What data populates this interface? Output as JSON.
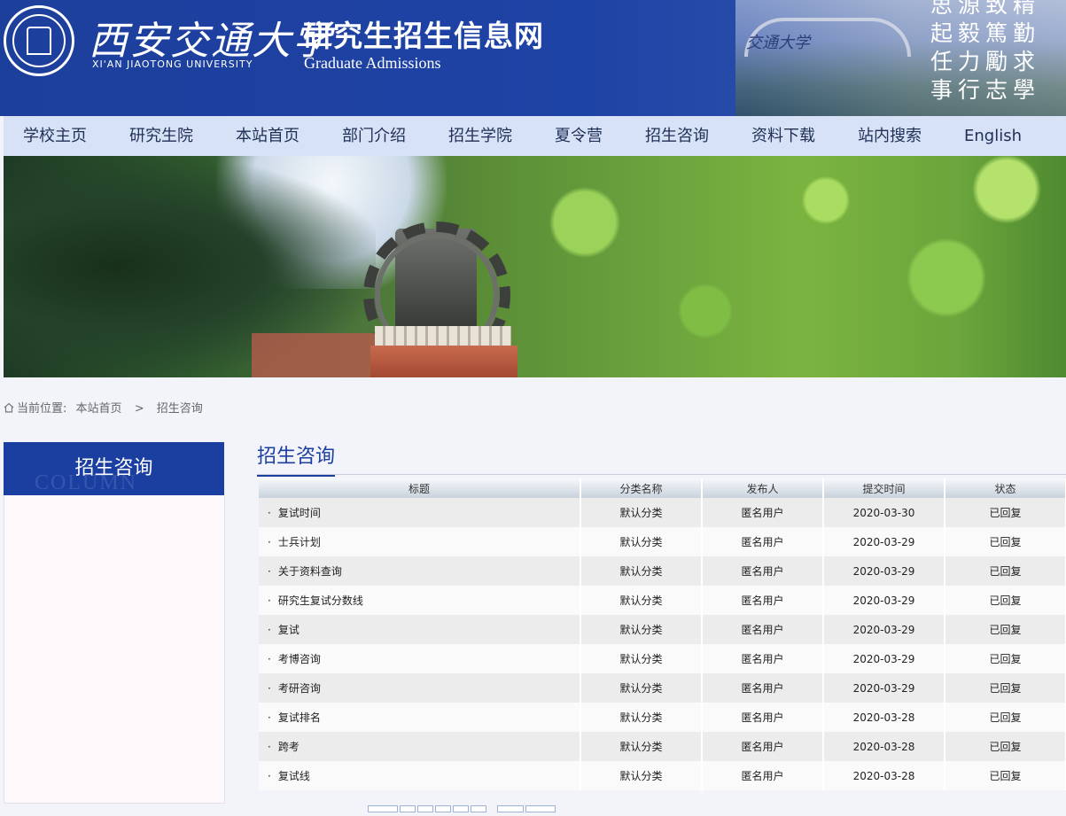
{
  "header": {
    "university_cn": "西安交通大学",
    "university_en": "XI'AN JIAOTONG UNIVERSITY",
    "site_title": "研究生招生信息网",
    "site_subtitle": "Graduate Admissions",
    "gate_text": "交通大学",
    "motto": [
      "思源致精",
      "起毅篤勤",
      "任力勵求",
      "事行志學"
    ]
  },
  "nav": {
    "items": [
      "学校主页",
      "研究生院",
      "本站首页",
      "部门介绍",
      "招生学院",
      "夏令营",
      "招生咨询",
      "资料下载",
      "站内搜索",
      "English"
    ]
  },
  "breadcrumb": {
    "label": "当前位置:",
    "home": "本站首页",
    "separator": ">",
    "current": "招生咨询"
  },
  "sidebar": {
    "title": "招生咨询",
    "ghost": "COLUMN"
  },
  "main": {
    "title": "招生咨询",
    "columns": [
      "标题",
      "分类名称",
      "发布人",
      "提交时间",
      "状态"
    ],
    "bullet": "·",
    "rows": [
      {
        "title": "复试时间",
        "category": "默认分类",
        "publisher": "匿名用户",
        "date": "2020-03-30",
        "status": "已回复"
      },
      {
        "title": "士兵计划",
        "category": "默认分类",
        "publisher": "匿名用户",
        "date": "2020-03-29",
        "status": "已回复"
      },
      {
        "title": "关于资料查询",
        "category": "默认分类",
        "publisher": "匿名用户",
        "date": "2020-03-29",
        "status": "已回复"
      },
      {
        "title": "研究生复试分数线",
        "category": "默认分类",
        "publisher": "匿名用户",
        "date": "2020-03-29",
        "status": "已回复"
      },
      {
        "title": "复试",
        "category": "默认分类",
        "publisher": "匿名用户",
        "date": "2020-03-29",
        "status": "已回复"
      },
      {
        "title": "考博咨询",
        "category": "默认分类",
        "publisher": "匿名用户",
        "date": "2020-03-29",
        "status": "已回复"
      },
      {
        "title": "考研咨询",
        "category": "默认分类",
        "publisher": "匿名用户",
        "date": "2020-03-29",
        "status": "已回复"
      },
      {
        "title": "复试排名",
        "category": "默认分类",
        "publisher": "匿名用户",
        "date": "2020-03-28",
        "status": "已回复"
      },
      {
        "title": "跨考",
        "category": "默认分类",
        "publisher": "匿名用户",
        "date": "2020-03-28",
        "status": "已回复"
      },
      {
        "title": "复试线",
        "category": "默认分类",
        "publisher": "匿名用户",
        "date": "2020-03-28",
        "status": "已回复"
      }
    ]
  },
  "icons": {
    "home": "home-icon",
    "seal": "university-seal-icon"
  }
}
